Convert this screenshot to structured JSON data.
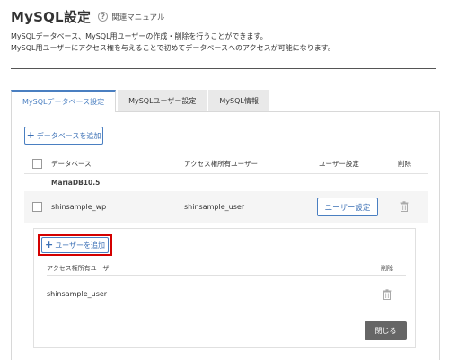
{
  "header": {
    "title": "MySQL設定",
    "manual_label": "関連マニュアル"
  },
  "description": {
    "line1": "MySQLデータベース、MySQL用ユーザーの作成・削除を行うことができます。",
    "line2": "MySQL用ユーザーにアクセス権を与えることで初めてデータベースへのアクセスが可能になります。"
  },
  "tabs": [
    {
      "label": "MySQLデータベース設定",
      "active": true
    },
    {
      "label": "MySQLユーザー設定",
      "active": false
    },
    {
      "label": "MySQL情報",
      "active": false
    }
  ],
  "actions": {
    "add_database": "データベースを追加",
    "add_user": "ユーザーを追加",
    "close": "閉じる"
  },
  "db_table": {
    "columns": [
      "データベース",
      "アクセス権所有ユーザー",
      "ユーザー設定",
      "削除"
    ],
    "group": "MariaDB10.5",
    "rows": [
      {
        "database": "shinsample_wp",
        "user": "shinsample_user",
        "user_setting_label": "ユーザー設定"
      }
    ]
  },
  "user_table": {
    "columns": [
      "アクセス権所有ユーザー",
      "削除"
    ],
    "rows": [
      {
        "user": "shinsample_user"
      }
    ]
  },
  "colors": {
    "accent": "#4a7fc1",
    "highlight": "#d40000",
    "close_button": "#666666"
  }
}
